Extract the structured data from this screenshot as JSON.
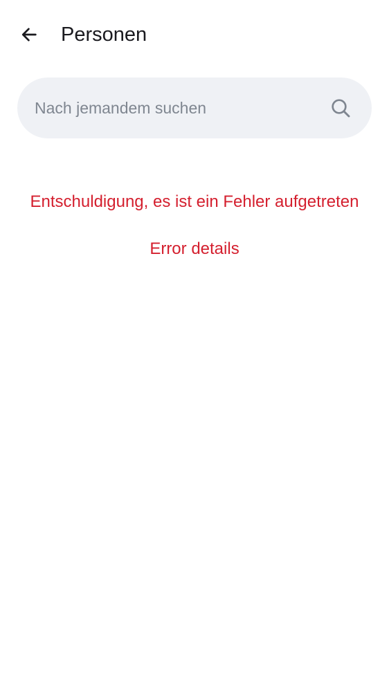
{
  "header": {
    "back_icon": "arrow-left-icon",
    "title": "Personen"
  },
  "search": {
    "placeholder": "Nach jemandem suchen",
    "value": "",
    "icon": "search-icon"
  },
  "error": {
    "message": "Entschuldigung, es ist ein Fehler aufgetreten",
    "details_label": "Error details"
  },
  "colors": {
    "error": "#d41f2e",
    "search_background": "#eff1f5",
    "placeholder": "#7f8690",
    "title": "#1a1a1f"
  }
}
